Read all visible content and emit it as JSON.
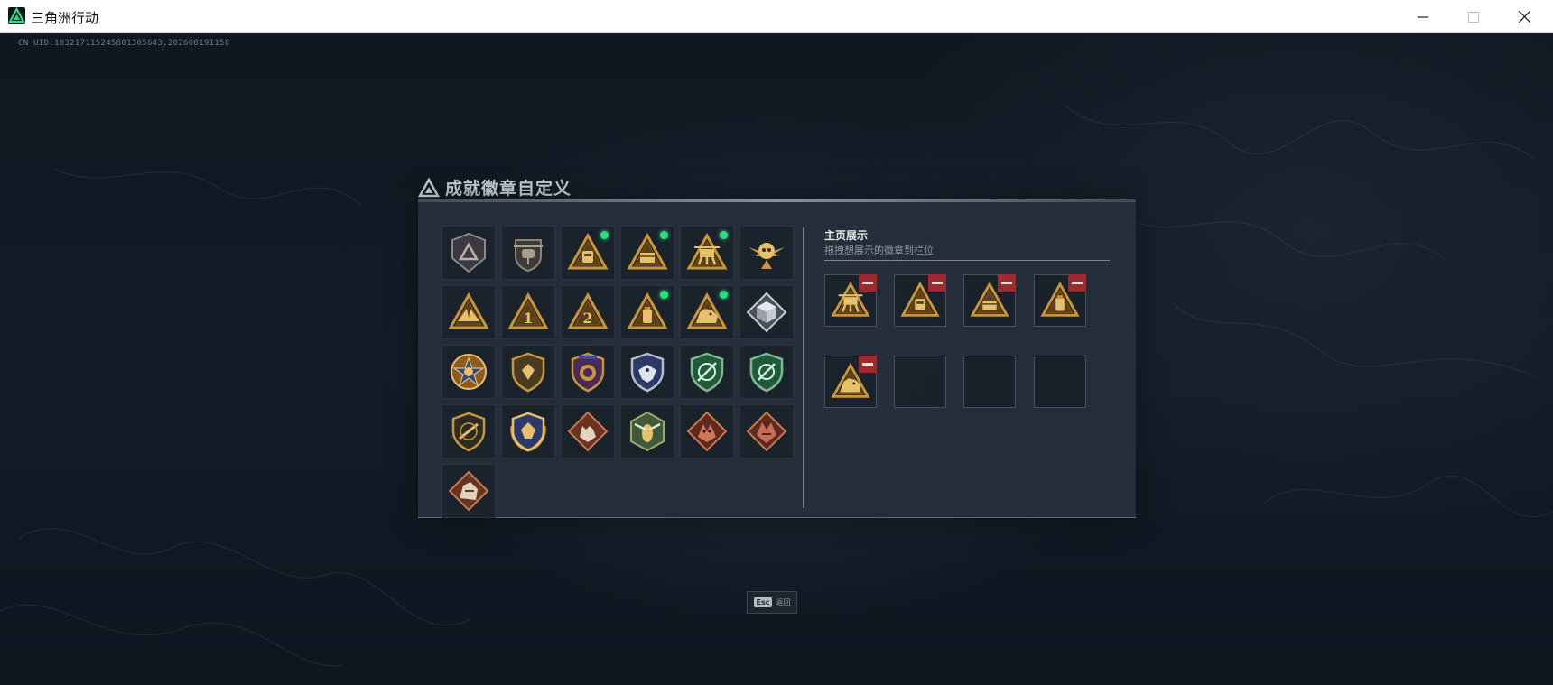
{
  "window": {
    "title": "三角洲行动",
    "uid": "CN UID:183217115245801305643,202608191150"
  },
  "panel": {
    "title": "成就徽章自定义",
    "display_heading": "主页展示",
    "display_subtitle": "拖拽想展示的徽章到栏位"
  },
  "esc": {
    "key": "Esc",
    "label": "返回"
  },
  "colors": {
    "gold": "#c8963a",
    "gold_light": "#e6c06a",
    "new_dot": "#26e07c",
    "remove": "#9d2a2f",
    "panel_bg": "#26303c"
  },
  "badges": [
    {
      "icon": "shield-delta-icon",
      "style": "gray",
      "new": false
    },
    {
      "icon": "helicopter-shield-icon",
      "style": "gray",
      "new": false
    },
    {
      "icon": "triangle-vest-icon",
      "style": "gold",
      "new": true
    },
    {
      "icon": "triangle-box-icon",
      "style": "gold",
      "new": true
    },
    {
      "icon": "triangle-mech-icon",
      "style": "gold",
      "new": true
    },
    {
      "icon": "winged-skull-icon",
      "style": "gold",
      "new": false
    },
    {
      "icon": "triangle-wings-icon",
      "style": "gold",
      "new": false
    },
    {
      "icon": "triangle-number-1-icon",
      "style": "gold",
      "new": false
    },
    {
      "icon": "triangle-number-2-icon",
      "style": "gold",
      "new": false
    },
    {
      "icon": "triangle-canister-icon",
      "style": "gold",
      "new": true
    },
    {
      "icon": "triangle-beast-icon",
      "style": "gold",
      "new": true
    },
    {
      "icon": "silver-cube-icon",
      "style": "silver",
      "new": false
    },
    {
      "icon": "star-medal-icon",
      "style": "medal",
      "new": false
    },
    {
      "icon": "small-shield-icon",
      "style": "gold",
      "new": false
    },
    {
      "icon": "purple-shield-icon",
      "style": "purple",
      "new": false
    },
    {
      "icon": "eagle-shield-icon",
      "style": "blue",
      "new": false
    },
    {
      "icon": "green-crosshair-shield-icon",
      "style": "green",
      "new": false
    },
    {
      "icon": "green-crosshair-laurel-icon",
      "style": "green",
      "new": false
    },
    {
      "icon": "rifle-shield-icon",
      "style": "gold",
      "new": false
    },
    {
      "icon": "laurel-crest-icon",
      "style": "gold",
      "new": false
    },
    {
      "icon": "wolf-diamond-icon",
      "style": "rust",
      "new": false
    },
    {
      "icon": "hornet-hexagon-icon",
      "style": "greengold",
      "new": false
    },
    {
      "icon": "dragon-diamond-icon",
      "style": "rust",
      "new": false
    },
    {
      "icon": "dragon-diamond-alt-icon",
      "style": "rust",
      "new": false
    },
    {
      "icon": "beast-diamond-icon",
      "style": "rust",
      "new": false
    }
  ],
  "display_slots": [
    {
      "icon": "triangle-mech-icon",
      "filled": true
    },
    {
      "icon": "triangle-vest-icon",
      "filled": true
    },
    {
      "icon": "triangle-box-icon",
      "filled": true
    },
    {
      "icon": "triangle-canister-icon",
      "filled": true
    },
    {
      "icon": "triangle-beast-icon",
      "filled": true
    },
    {
      "icon": "",
      "filled": false
    },
    {
      "icon": "",
      "filled": false
    },
    {
      "icon": "",
      "filled": false
    }
  ]
}
